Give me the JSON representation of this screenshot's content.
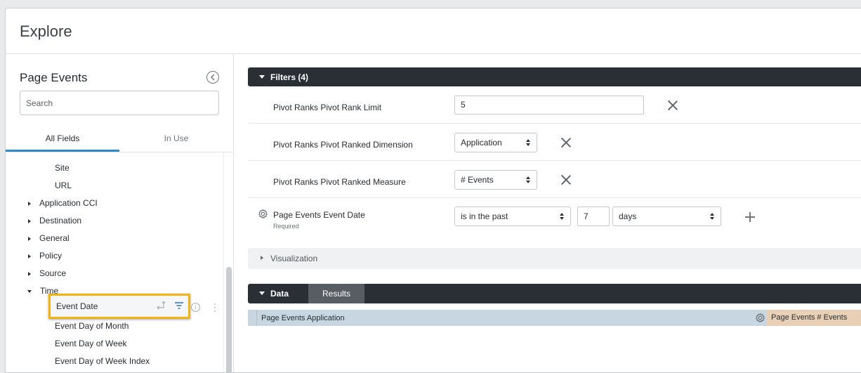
{
  "app": {
    "title": "Explore"
  },
  "sidebar": {
    "title": "Page Events",
    "search_placeholder": "Search",
    "tabs": [
      {
        "label": "All Fields",
        "active": true
      },
      {
        "label": "In Use",
        "active": false
      }
    ],
    "fields": [
      {
        "label": "Site",
        "type": "field"
      },
      {
        "label": "URL",
        "type": "field"
      },
      {
        "label": "Application CCI",
        "type": "group",
        "expanded": false
      },
      {
        "label": "Destination",
        "type": "group",
        "expanded": false
      },
      {
        "label": "General",
        "type": "group",
        "expanded": false
      },
      {
        "label": "Policy",
        "type": "group",
        "expanded": false
      },
      {
        "label": "Source",
        "type": "group",
        "expanded": false
      },
      {
        "label": "Time",
        "type": "group",
        "expanded": true
      },
      {
        "label": "Event Date",
        "type": "field",
        "highlighted": true
      },
      {
        "label": "Event Day of Month",
        "type": "field"
      },
      {
        "label": "Event Day of Week",
        "type": "field"
      },
      {
        "label": "Event Day of Week Index",
        "type": "field"
      }
    ],
    "highlight_color": "#f2b414"
  },
  "filters": {
    "header": "Filters (4)",
    "rows": [
      {
        "label": "Pivot Ranks Pivot Rank Limit",
        "value": "5"
      },
      {
        "label": "Pivot Ranks Pivot Ranked Dimension",
        "value": "Application"
      },
      {
        "label": "Pivot Ranks Pivot Ranked Measure",
        "value": "# Events"
      },
      {
        "label": "Page Events Event Date",
        "sublabel": "Required",
        "operator": "is in the past",
        "value": "7",
        "unit": "days"
      }
    ]
  },
  "visualization": {
    "label": "Visualization"
  },
  "data_section": {
    "tabs": [
      {
        "label": "Data",
        "active": true
      },
      {
        "label": "Results",
        "active": false
      }
    ],
    "columns": [
      {
        "label": "Page Events Application",
        "kind": "dimension",
        "color": "#c8d6e1"
      },
      {
        "label": "Page Events # Events",
        "kind": "measure",
        "color": "#e8cfb5"
      }
    ]
  },
  "colors": {
    "accent": "#2e8bc9",
    "dark_bar": "#2a2f36"
  }
}
